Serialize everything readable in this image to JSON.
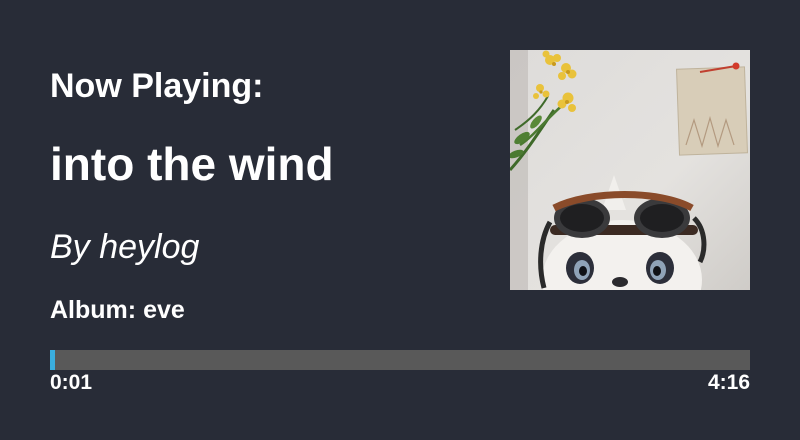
{
  "player": {
    "heading": "Now Playing:",
    "track_title": "into the wind",
    "artist_prefix": "By",
    "artist": "heylog",
    "album_prefix": "Album:",
    "album": "eve",
    "elapsed": "0:01",
    "duration": "4:16",
    "progress_fraction": 0.007
  },
  "colors": {
    "background": "#282c37",
    "text": "#ffffff",
    "progress_track": "#595959",
    "progress_fill": "#3aaede"
  }
}
